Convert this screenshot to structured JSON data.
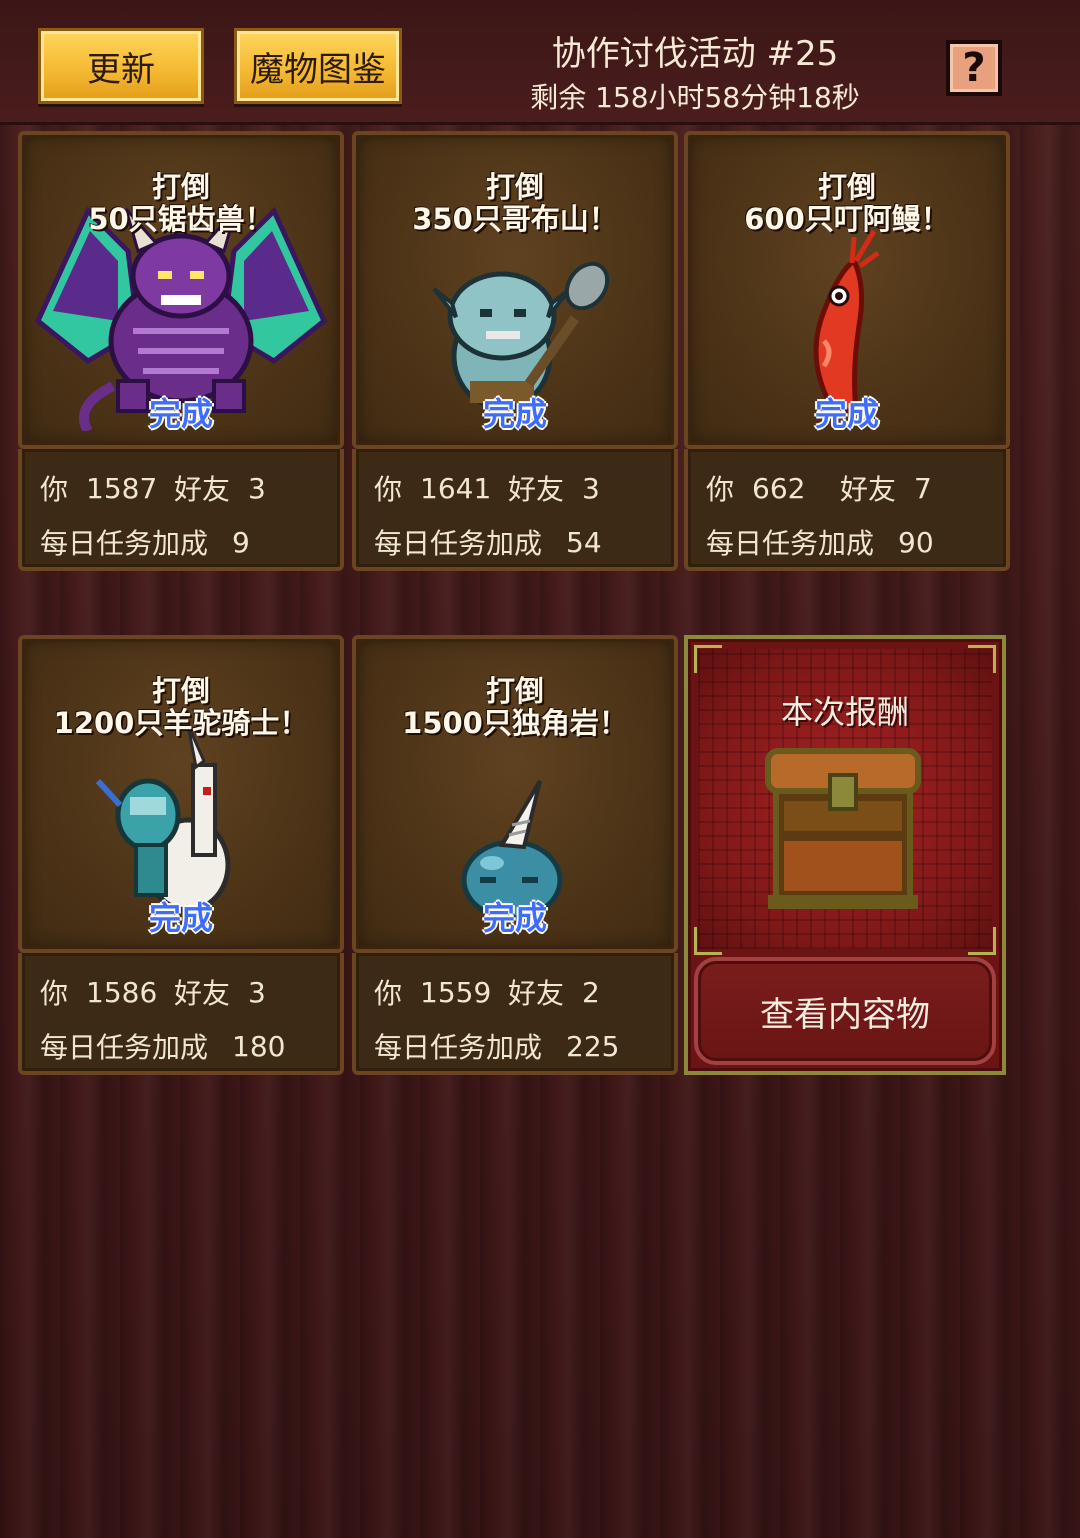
{
  "header": {
    "refresh_label": "更新",
    "bestiary_label": "魔物图鉴",
    "event_title": "协作讨伐活动 #25",
    "event_timer": "剩余 158小时58分钟18秒",
    "help_label": "?"
  },
  "labels": {
    "you": "你",
    "friends": "好友",
    "daily_bonus": "每日任务加成",
    "done": "完成"
  },
  "quests": [
    {
      "task_line1": "打倒",
      "task_line2": "50只锯齿兽！",
      "status": "完成",
      "you": "1587",
      "friends": "3",
      "bonus": "9",
      "monster": "winged-purple-demon",
      "colors": {
        "body": "#6b2d8a",
        "wing": "#33c7a0"
      }
    },
    {
      "task_line1": "打倒",
      "task_line2": "350只哥布山！",
      "status": "完成",
      "you": "1641",
      "friends": "3",
      "bonus": "54",
      "monster": "goblin-with-club",
      "colors": {
        "body": "#7fb4b8"
      }
    },
    {
      "task_line1": "打倒",
      "task_line2": "600只叮阿鳗！",
      "status": "完成",
      "you": "662",
      "friends": "7",
      "bonus": "90",
      "monster": "red-eel",
      "colors": {
        "body": "#e23a22"
      }
    },
    {
      "task_line1": "打倒",
      "task_line2": "1200只羊驼骑士！",
      "status": "完成",
      "you": "1586",
      "friends": "3",
      "bonus": "180",
      "monster": "knight-on-llama",
      "colors": {
        "body": "#3aa2a8"
      }
    },
    {
      "task_line1": "打倒",
      "task_line2": "1500只独角岩！",
      "status": "完成",
      "you": "1559",
      "friends": "2",
      "bonus": "225",
      "monster": "horned-blob",
      "colors": {
        "body": "#3b8ea3"
      }
    }
  ],
  "reward": {
    "title": "本次报酬",
    "button_label": "查看内容物",
    "icon": "treasure-chest-icon"
  },
  "colors": {
    "status_blue": "#3e6cff",
    "button_yellow": "#f4b730",
    "reward_red": "#6c1414"
  }
}
